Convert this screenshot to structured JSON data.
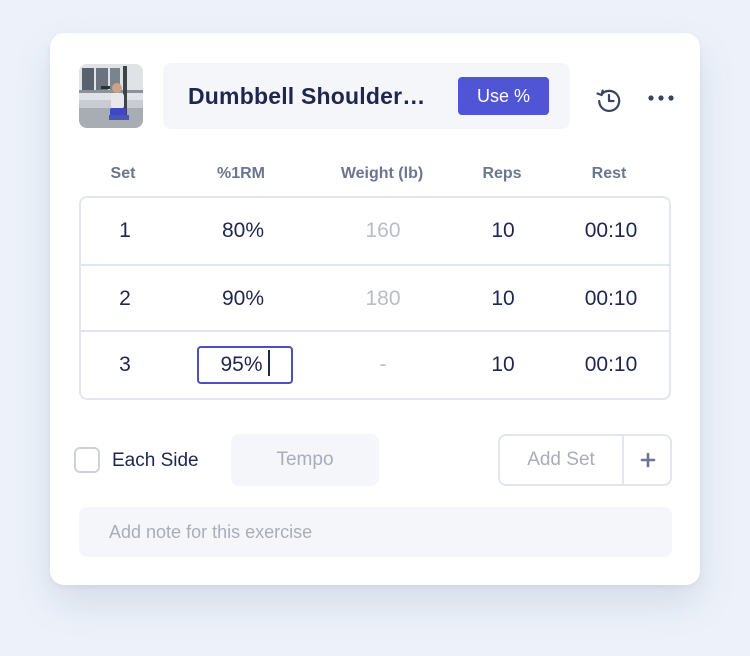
{
  "exercise": {
    "title": "Dumbbell Shoulder Press",
    "title_display": "Dumbbell Shoulder…",
    "thumbnail": "exercise-photo",
    "use_percent_label": "Use %"
  },
  "icons": {
    "history": "history-icon",
    "more": "more-horizontal-icon",
    "plus": "plus-icon"
  },
  "columns": [
    "Set",
    "%1RM",
    "Weight (lb)",
    "Reps",
    "Rest"
  ],
  "sets": [
    {
      "set": "1",
      "pct": "80%",
      "weight": "160",
      "reps": "10",
      "rest": "00:10"
    },
    {
      "set": "2",
      "pct": "90%",
      "weight": "180",
      "reps": "10",
      "rest": "00:10"
    },
    {
      "set": "3",
      "pct": "95%",
      "weight": "-",
      "reps": "10",
      "rest": "00:10"
    }
  ],
  "controls": {
    "each_side_label": "Each Side",
    "each_side_checked": false,
    "tempo_placeholder": "Tempo",
    "add_set_label": "Add Set",
    "note_placeholder": "Add note for this exercise"
  },
  "colors": {
    "accent": "#5055d6",
    "text": "#1f2650",
    "muted": "#b9bdc9",
    "background": "#edf2fa"
  }
}
